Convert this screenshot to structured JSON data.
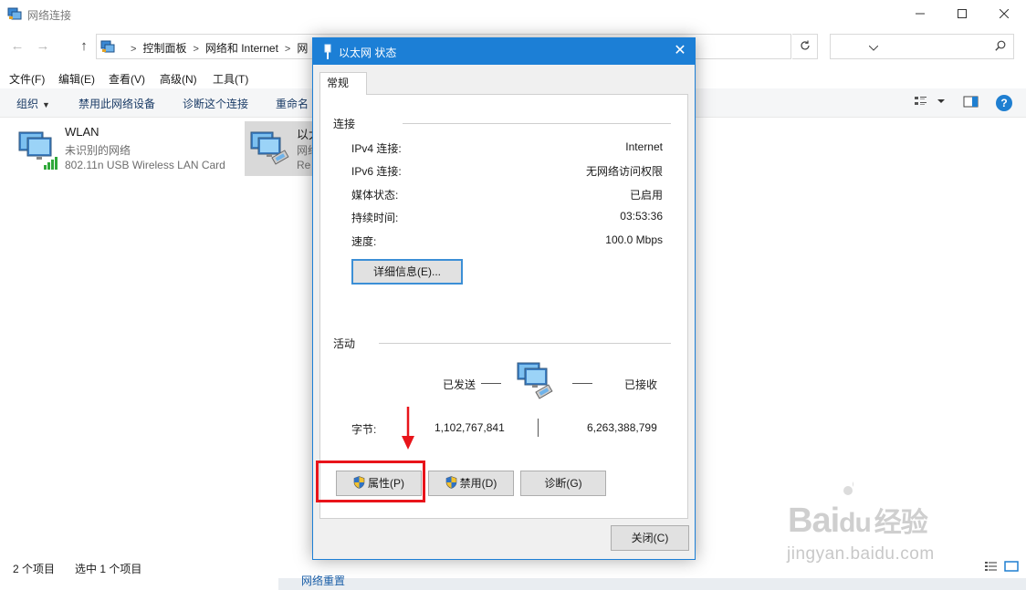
{
  "window": {
    "title": "网络连接",
    "minimize": "—",
    "maximize": "☐",
    "close": "✕"
  },
  "nav": {
    "back": "←",
    "forward": "→",
    "up": "↑",
    "breadcrumbs": [
      "控制面板",
      "网络和 Internet",
      "网"
    ],
    "search_placeholder": ""
  },
  "menu": [
    "文件(F)",
    "编辑(E)",
    "查看(V)",
    "高级(N)",
    "工具(T)"
  ],
  "commands": {
    "organize": "组织",
    "disable_device": "禁用此网络设备",
    "diagnose": "诊断这个连接",
    "rename": "重命名",
    "help": "?"
  },
  "items": [
    {
      "name": "WLAN",
      "status": "未识别的网络",
      "adapter": "802.11n USB Wireless LAN Card"
    },
    {
      "name": "以太",
      "status": "网络",
      "adapter": "Re"
    }
  ],
  "statusbar": {
    "count": "2 个项目",
    "selected": "选中 1 个项目",
    "bottom_link": "网络重置"
  },
  "dialog": {
    "title": "以太网 状态",
    "close": "✕",
    "tab": "常规",
    "connection": {
      "heading": "连接",
      "rows": [
        {
          "label": "IPv4 连接:",
          "value": "Internet"
        },
        {
          "label": "IPv6 连接:",
          "value": "无网络访问权限"
        },
        {
          "label": "媒体状态:",
          "value": "已启用"
        },
        {
          "label": "持续时间:",
          "value": "03:53:36"
        },
        {
          "label": "速度:",
          "value": "100.0 Mbps"
        }
      ],
      "details_button": "详细信息(E)..."
    },
    "activity": {
      "heading": "活动",
      "sent_label": "已发送",
      "received_label": "已接收",
      "bytes_label": "字节:",
      "bytes_sent": "1,102,767,841",
      "bytes_received": "6,263,388,799"
    },
    "buttons": {
      "properties": "属性(P)",
      "disable": "禁用(D)",
      "diagnose": "诊断(G)",
      "close": "关闭(C)"
    }
  },
  "watermark": {
    "site": "jingyan.baidu.com",
    "logo": "Bai",
    "logo2": "du",
    "logo_cn": "经验"
  },
  "colors": {
    "accent": "#1c7fd6",
    "annotation": "#e8141a"
  }
}
